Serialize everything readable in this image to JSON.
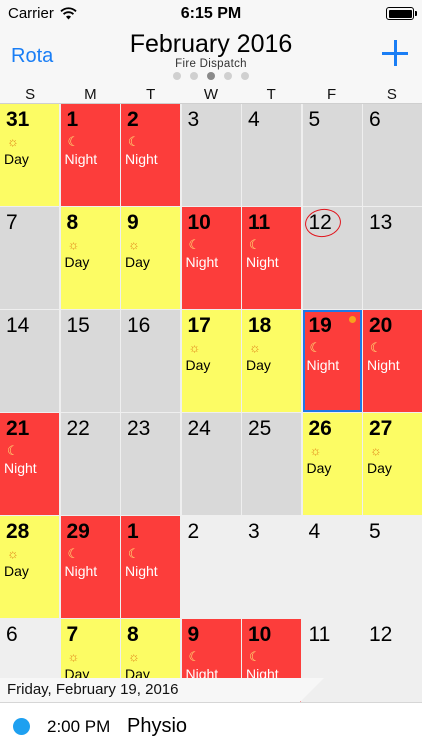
{
  "status": {
    "carrier": "Carrier",
    "time": "6:15 PM"
  },
  "nav": {
    "left": "Rota",
    "title": "February 2016",
    "subtitle": "Fire Dispatch"
  },
  "weekdays": [
    "S",
    "M",
    "T",
    "W",
    "T",
    "F",
    "S"
  ],
  "shift_labels": {
    "day": "Day",
    "night": "Night"
  },
  "days": [
    {
      "n": "31",
      "s": "day"
    },
    {
      "n": "1",
      "s": "night"
    },
    {
      "n": "2",
      "s": "night"
    },
    {
      "n": "3",
      "s": "off"
    },
    {
      "n": "4",
      "s": "off"
    },
    {
      "n": "5",
      "s": "off"
    },
    {
      "n": "6",
      "s": "off"
    },
    {
      "n": "7",
      "s": "off"
    },
    {
      "n": "8",
      "s": "day"
    },
    {
      "n": "9",
      "s": "day"
    },
    {
      "n": "10",
      "s": "night"
    },
    {
      "n": "11",
      "s": "night"
    },
    {
      "n": "12",
      "s": "off",
      "today": true
    },
    {
      "n": "13",
      "s": "off"
    },
    {
      "n": "14",
      "s": "off"
    },
    {
      "n": "15",
      "s": "off"
    },
    {
      "n": "16",
      "s": "off"
    },
    {
      "n": "17",
      "s": "day"
    },
    {
      "n": "18",
      "s": "day"
    },
    {
      "n": "19",
      "s": "night",
      "selected": true,
      "event": true
    },
    {
      "n": "20",
      "s": "night"
    },
    {
      "n": "21",
      "s": "night"
    },
    {
      "n": "22",
      "s": "off"
    },
    {
      "n": "23",
      "s": "off"
    },
    {
      "n": "24",
      "s": "off"
    },
    {
      "n": "25",
      "s": "off"
    },
    {
      "n": "26",
      "s": "day"
    },
    {
      "n": "27",
      "s": "day"
    },
    {
      "n": "28",
      "s": "day"
    },
    {
      "n": "29",
      "s": "night"
    },
    {
      "n": "1",
      "s": "night"
    },
    {
      "n": "2",
      "s": "off",
      "outside": true
    },
    {
      "n": "3",
      "s": "off",
      "outside": true
    },
    {
      "n": "4",
      "s": "off",
      "outside": true
    },
    {
      "n": "5",
      "s": "off",
      "outside": true
    },
    {
      "n": "6",
      "s": "off",
      "outside": true
    },
    {
      "n": "7",
      "s": "day"
    },
    {
      "n": "8",
      "s": "day"
    },
    {
      "n": "9",
      "s": "night"
    },
    {
      "n": "10",
      "s": "night"
    },
    {
      "n": "11",
      "s": "off",
      "outside": true
    },
    {
      "n": "12",
      "s": "off",
      "outside": true
    }
  ],
  "selected_date": "Friday, February 19, 2016",
  "event": {
    "time": "2:00 PM",
    "title": "Physio",
    "color": "#1ea0f0"
  },
  "colors": {
    "accent": "#1a7ef5",
    "day_shift": "#fcfc64",
    "night_shift": "#fc3d3b",
    "off": "#d9d9d9"
  }
}
